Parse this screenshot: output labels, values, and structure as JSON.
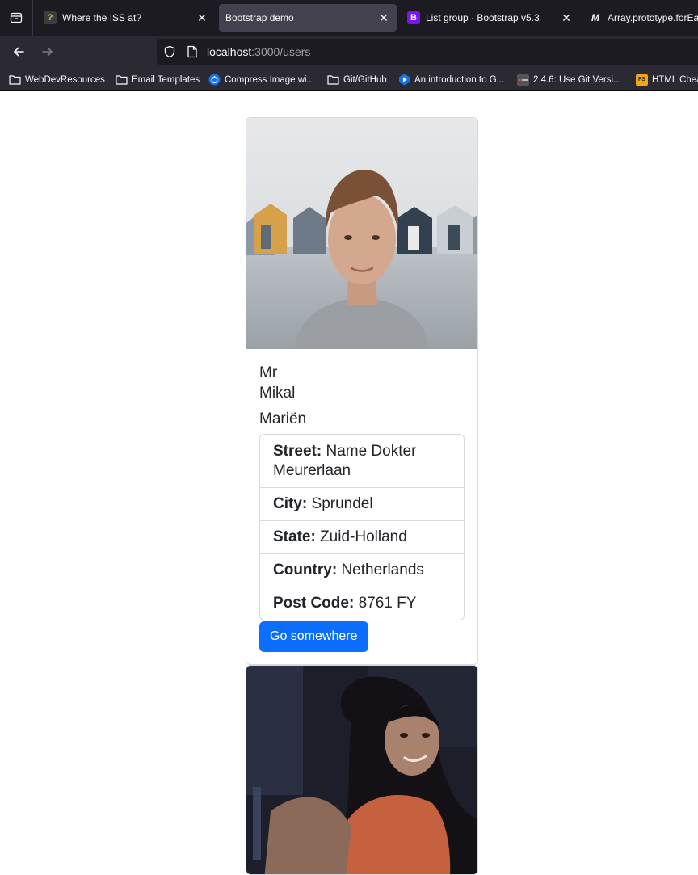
{
  "browser": {
    "tabs": [
      {
        "title": "Where the ISS at?",
        "favicon": "question-mark-icon",
        "active": false
      },
      {
        "title": "Bootstrap demo",
        "favicon": "",
        "active": true
      },
      {
        "title": "List group · Bootstrap v5.3",
        "favicon": "bootstrap-icon",
        "active": false
      },
      {
        "title": "Array.prototype.forEach",
        "favicon": "mdn-icon",
        "active": false
      }
    ],
    "url_host": "localhost",
    "url_path": ":3000/users",
    "bookmarks": [
      {
        "label": "WebDevResources",
        "icon": "folder-icon"
      },
      {
        "label": "Email Templates",
        "icon": "folder-icon"
      },
      {
        "label": "Compress Image wi...",
        "icon": "compress-icon"
      },
      {
        "label": "Git/GitHub",
        "icon": "folder-icon"
      },
      {
        "label": "An introduction to G...",
        "icon": "play-icon"
      },
      {
        "label": "2.4.6: Use Git Versi...",
        "icon": "site-icon"
      },
      {
        "label": "HTML Chea",
        "icon": "fs-icon"
      }
    ],
    "accent": "#42414d"
  },
  "users": [
    {
      "title": "Mr",
      "first": "Mikal",
      "last": "Mariën",
      "fields": [
        {
          "label": "Street:",
          "value": "Name Dokter Meurerlaan"
        },
        {
          "label": "City:",
          "value": "Sprundel"
        },
        {
          "label": "State:",
          "value": "Zuid-Holland"
        },
        {
          "label": "Country:",
          "value": "Netherlands"
        },
        {
          "label": "Post Code:",
          "value": "8761 FY"
        }
      ],
      "button": "Go somewhere"
    }
  ],
  "colors": {
    "primary": "#0d6efd",
    "border": "#dee2e6",
    "text": "#212529"
  }
}
